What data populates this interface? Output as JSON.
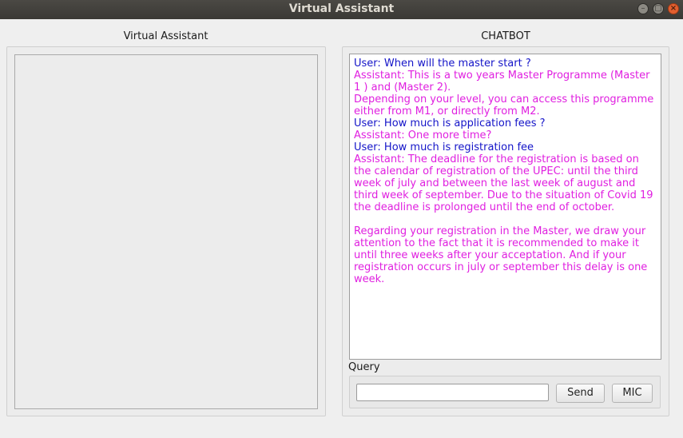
{
  "window": {
    "title": "Virtual Assistant"
  },
  "left_panel": {
    "title": "Virtual Assistant"
  },
  "right_panel": {
    "title": "CHATBOT",
    "messages": [
      {
        "role": "user",
        "text": "User: When will the master start ?"
      },
      {
        "role": "assistant",
        "text": "Assistant: This is a two years Master Programme (Master 1 ) and (Master 2).\nDepending on your level, you can access this programme either from M1, or directly from M2."
      },
      {
        "role": "user",
        "text": "User: How much is application fees ?"
      },
      {
        "role": "assistant",
        "text": "Assistant: One more time?"
      },
      {
        "role": "user",
        "text": "User: How much is registration fee"
      },
      {
        "role": "assistant",
        "text": "Assistant: The deadline for the registration is based on the calendar of registration of the UPEC: until the third week of july and between the last week of august and third week of september. Due to the situation of Covid 19 the deadline is prolonged until the end of october.\n\nRegarding your registration in the Master, we draw your attention to the fact that it is recommended to make it until three weeks after your acceptation. And if your registration occurs in july or september this delay is one week."
      }
    ],
    "query_label": "Query",
    "query_value": "",
    "send_label": "Send",
    "mic_label": "MIC"
  },
  "colors": {
    "user_text": "#1414c8",
    "assistant_text": "#e020e0",
    "selection": "#2f73b8",
    "close_button": "#e35f2f"
  }
}
